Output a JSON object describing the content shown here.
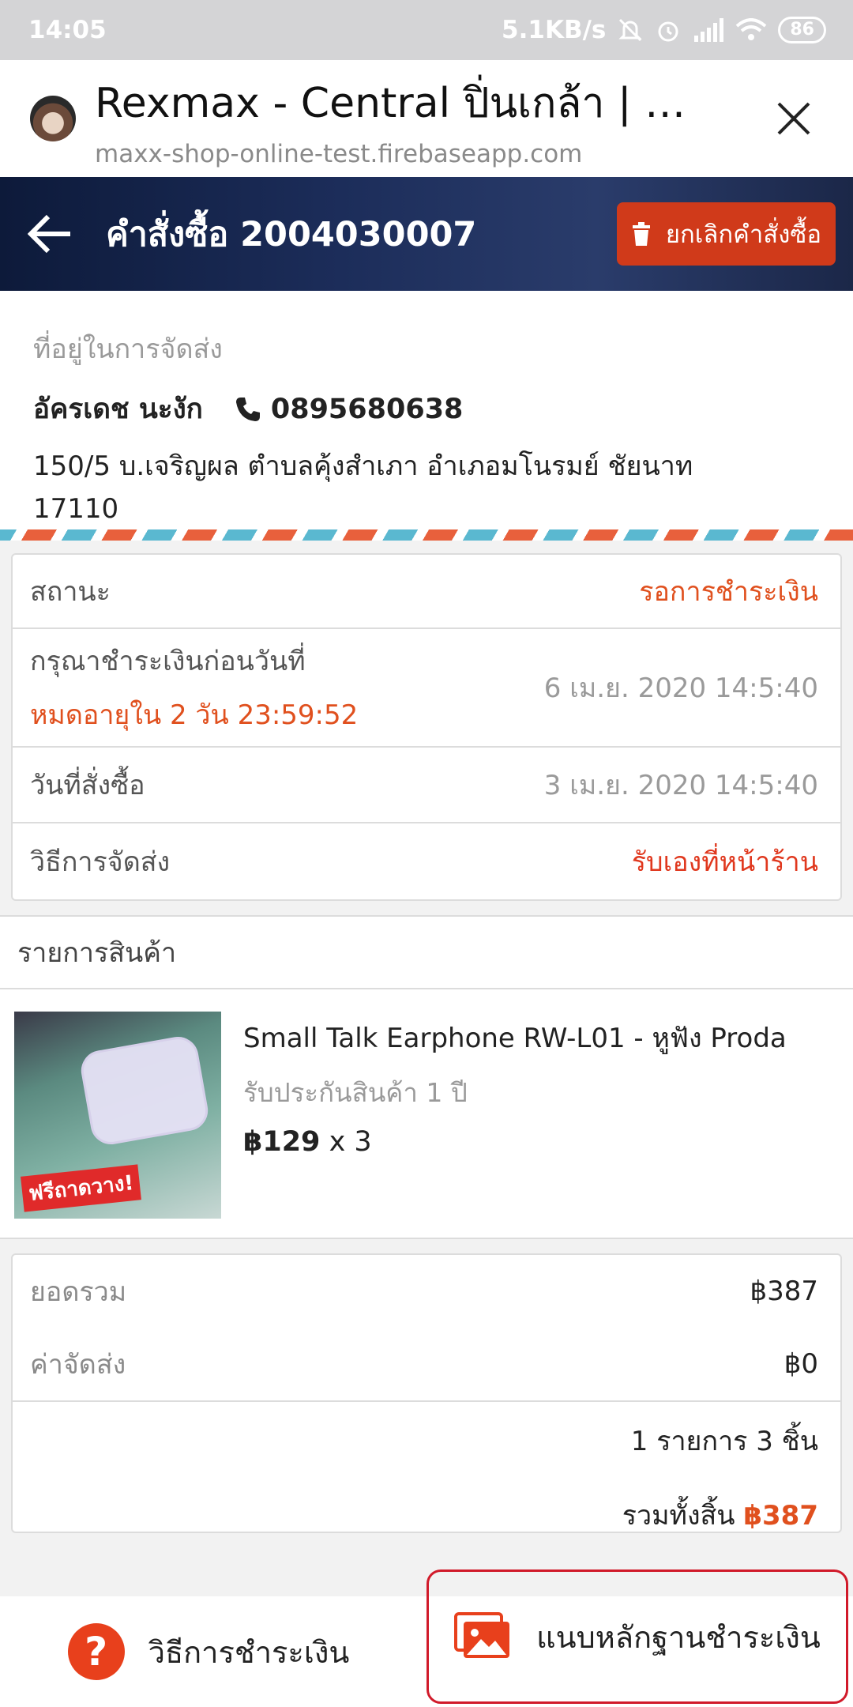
{
  "status_bar": {
    "time": "14:05",
    "net_speed": "5.1KB/s",
    "battery": "86"
  },
  "browser": {
    "title": "Rexmax - Central ปิ่นเกล้า | คำ...",
    "url": "maxx-shop-online-test.firebaseapp.com",
    "close_icon": "close-icon"
  },
  "header": {
    "title": "คำสั่งซื้อ 2004030007",
    "cancel_label": "ยกเลิกคำสั่งซื้อ",
    "bg_color": "#1c2d5a",
    "cancel_color": "#d03a1a"
  },
  "address": {
    "label": "ที่อยู่ในการจัดส่ง",
    "name": "อัครเดช นะงัก",
    "phone": "0895680638",
    "line1": "150/5 บ.เจริญผล ตำบลคุ้งสำเภา อำเภอมโนรมย์ ชัยนาท",
    "line2": "17110"
  },
  "order_info": {
    "status_label": "สถานะ",
    "status_value": "รอการชำระเงิน",
    "deadline_label": "กรุณาชำระเงินก่อนวันที่",
    "countdown": "หมดอายุใน 2 วัน 23:59:52",
    "deadline_value": "6 เม.ย. 2020 14:5:40",
    "order_date_label": "วันที่สั่งซื้อ",
    "order_date_value": "3 เม.ย. 2020 14:5:40",
    "shipping_label": "วิธีการจัดส่ง",
    "shipping_value": "รับเองที่หน้าร้าน"
  },
  "products": {
    "header": "รายการสินค้า",
    "items": [
      {
        "name": "Small Talk Earphone RW-L01 - หูฟัง Proda",
        "warranty": "รับประกันสินค้า 1 ปี",
        "price": "฿129",
        "qty": "x 3",
        "promo": "ฟรีถาดวาง!"
      }
    ]
  },
  "totals": {
    "subtotal_label": "ยอดรวม",
    "subtotal_value": "฿387",
    "shipping_label": "ค่าจัดส่ง",
    "shipping_value": "฿0",
    "count_text": "1 รายการ 3 ชิ้น",
    "grand_label": "รวมทั้งสิ้น",
    "grand_value": "฿387"
  },
  "bottom": {
    "payment_method_label": "วิธีการชำระเงิน",
    "attach_proof_label": "แนบหลักฐานชำระเงิน",
    "accent_color": "#e8401c"
  }
}
